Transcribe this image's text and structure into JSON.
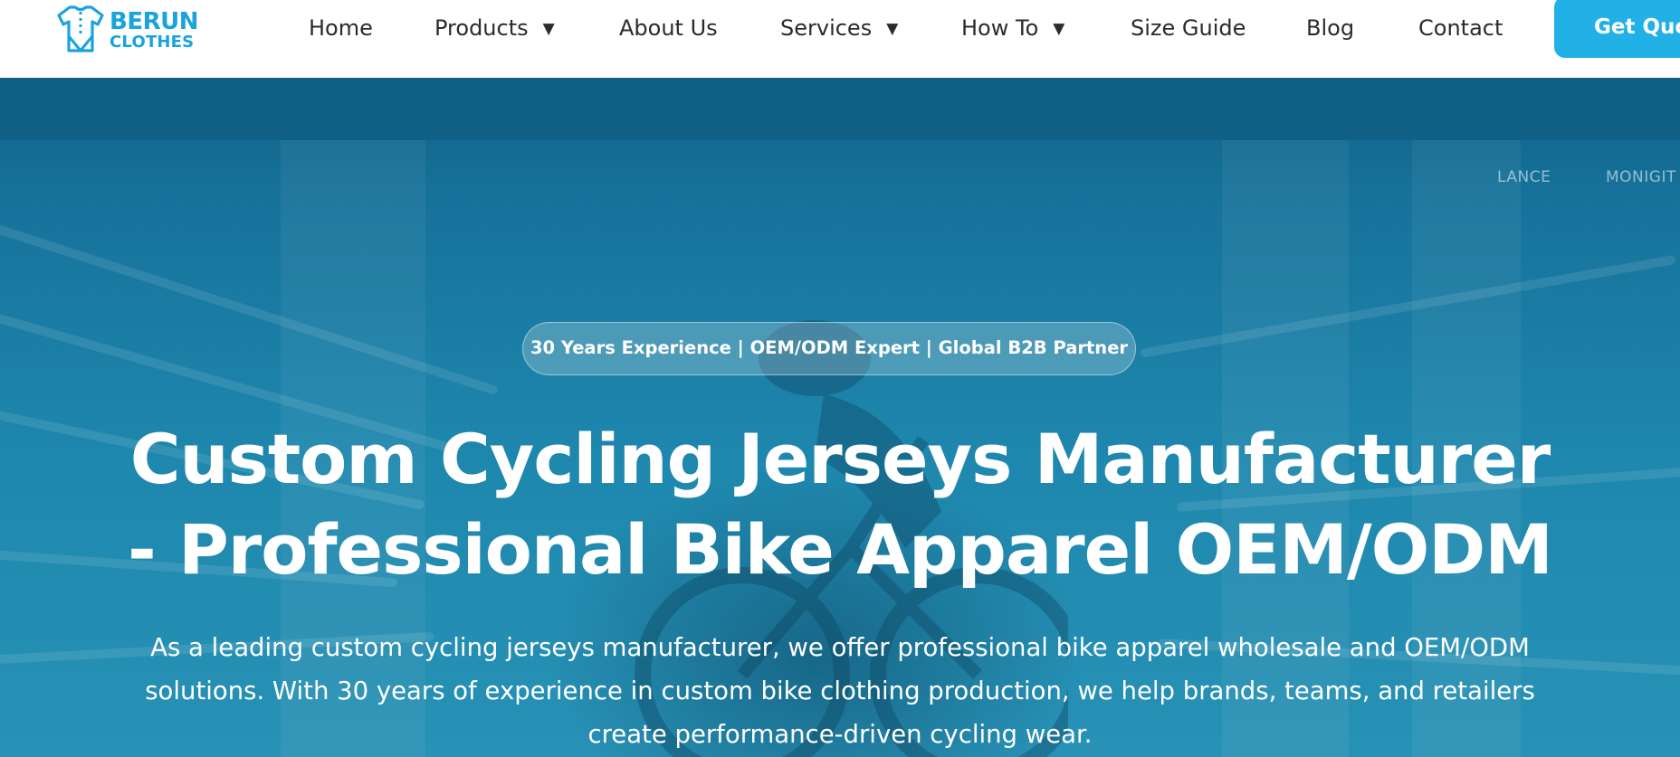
{
  "brand": {
    "line1": "BERUN",
    "line2": "CLOTHES",
    "logo_icon": "shirt-icon",
    "color": "#1aa3dc"
  },
  "nav": {
    "items": [
      {
        "label": "Home",
        "has_dropdown": false
      },
      {
        "label": "Products",
        "has_dropdown": true
      },
      {
        "label": "About Us",
        "has_dropdown": false
      },
      {
        "label": "Services",
        "has_dropdown": true
      },
      {
        "label": "How To",
        "has_dropdown": true
      },
      {
        "label": "Size Guide",
        "has_dropdown": false
      },
      {
        "label": "Blog",
        "has_dropdown": false
      },
      {
        "label": "Contact",
        "has_dropdown": false
      }
    ],
    "dropdown_glyph": "▼",
    "cta_label": "Get Quote",
    "cta_color": "#22b1e6"
  },
  "hero": {
    "background_signs": [
      "LANCE",
      "MONIGIT"
    ],
    "badge": "30 Years Experience | OEM/ODM Expert | Global B2B Partner",
    "title_lines": [
      "Custom Cycling Jerseys Manufacturer",
      "- Professional Bike Apparel OEM/ODM"
    ],
    "description_lines": [
      "As a leading custom cycling jerseys manufacturer, we offer professional bike apparel wholesale and OEM/ODM",
      "solutions. With 30 years of experience in custom bike clothing production, we help brands, teams, and retailers",
      "create performance-driven cycling wear."
    ],
    "overlay_color": "#1e87ad"
  }
}
